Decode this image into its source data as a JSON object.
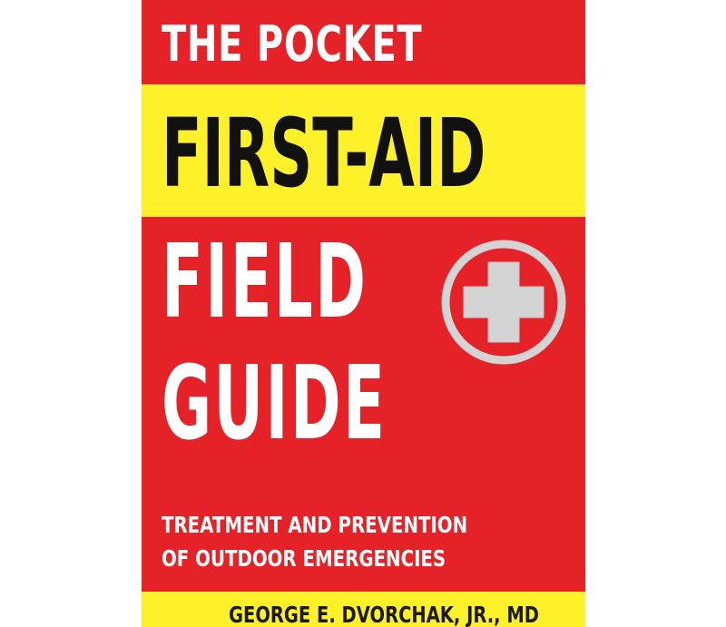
{
  "cover": {
    "title_line_1": "THE POCKET",
    "title_line_2": "FIRST-AID",
    "title_line_3": "FIELD",
    "title_line_4": "GUIDE",
    "subtitle_line_1": "TREATMENT AND PREVENTION",
    "subtitle_line_2": "OF OUTDOOR EMERGENCIES",
    "author": "GEORGE E. DVORCHAK, JR., MD",
    "emblem_icon": "medical-cross-icon"
  },
  "colors": {
    "background_red": "#e62229",
    "band_yellow": "#fef12a",
    "emblem_gray": "#d4d4d4"
  }
}
